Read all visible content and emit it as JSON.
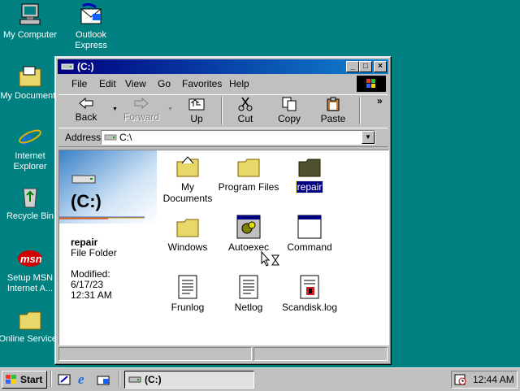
{
  "desktop": {
    "icons": [
      {
        "label": "My Computer"
      },
      {
        "label": "Outlook Express"
      },
      {
        "label": "My Documents"
      },
      {
        "label": "Internet Explorer"
      },
      {
        "label": "Recycle Bin"
      },
      {
        "label": "Setup MSN Internet A..."
      },
      {
        "label": "Online Services"
      }
    ]
  },
  "window": {
    "title": "(C:)",
    "menu": [
      "File",
      "Edit",
      "View",
      "Go",
      "Favorites",
      "Help"
    ],
    "toolbar": {
      "back": "Back",
      "forward": "Forward",
      "up": "Up",
      "cut": "Cut",
      "copy": "Copy",
      "paste": "Paste",
      "more": "»"
    },
    "address": {
      "label": "Address",
      "value": "C:\\"
    },
    "side": {
      "drive": "(C:)",
      "selected_name": "repair",
      "selected_type": "File Folder",
      "modified_label": "Modified:",
      "modified_date": "6/17/23",
      "modified_time": "12:31 AM"
    },
    "items": [
      {
        "label": "My Documents",
        "kind": "folder-special"
      },
      {
        "label": "Program Files",
        "kind": "folder"
      },
      {
        "label": "repair",
        "kind": "folder-selected"
      },
      {
        "label": "Windows",
        "kind": "folder"
      },
      {
        "label": "Autoexec",
        "kind": "batch"
      },
      {
        "label": "Command",
        "kind": "app"
      },
      {
        "label": "Frunlog",
        "kind": "text"
      },
      {
        "label": "Netlog",
        "kind": "text"
      },
      {
        "label": "Scandisk.log",
        "kind": "log"
      }
    ]
  },
  "taskbar": {
    "start": "Start",
    "task": "(C:)",
    "clock": "12:44 AM"
  },
  "colors": {
    "desktop": "#008080",
    "title_active": "#000080",
    "selection": "#000080"
  }
}
